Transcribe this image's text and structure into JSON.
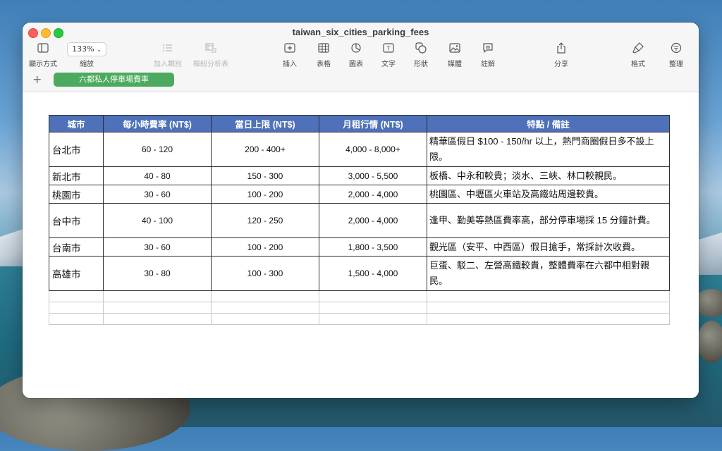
{
  "window": {
    "title": "taiwan_six_cities_parking_fees"
  },
  "toolbar": {
    "view_label": "顯示方式",
    "zoom_value": "133%",
    "zoom_label": "縮放",
    "add_category_label": "加入類別",
    "pivot_label": "樞紐分析表",
    "insert_label": "插入",
    "table_label": "表格",
    "chart_label": "圖表",
    "text_label": "文字",
    "shape_label": "形狀",
    "media_label": "媒體",
    "comment_label": "註解",
    "share_label": "分享",
    "format_label": "格式",
    "organize_label": "整理"
  },
  "sheets": {
    "add_icon": "plus-icon",
    "active_tab": "六都私人停車場費率"
  },
  "table": {
    "headers": [
      "城市",
      "每小時費率 (NT$)",
      "當日上限 (NT$)",
      "月租行情 (NT$)",
      "特點 / 備註"
    ],
    "rows": [
      {
        "city": "台北市",
        "hourly": "60 - 120",
        "daily": "200 - 400+",
        "monthly": "4,000 - 8,000+",
        "note": "精華區假日 $100 - 150/hr 以上，熱門商圈假日多不設上限。"
      },
      {
        "city": "新北市",
        "hourly": "40 - 80",
        "daily": "150 - 300",
        "monthly": "3,000 - 5,500",
        "note": "板橋、中永和較貴；淡水、三峽、林口較親民。"
      },
      {
        "city": "桃園市",
        "hourly": "30 - 60",
        "daily": "100 - 200",
        "monthly": "2,000 - 4,000",
        "note": "桃園區、中壢區火車站及高鐵站周邊較貴。"
      },
      {
        "city": "台中市",
        "hourly": "40 - 100",
        "daily": "120 - 250",
        "monthly": "2,000 - 4,000",
        "note": "逢甲、勤美等熱區費率高，部分停車場採 15 分鐘計費。"
      },
      {
        "city": "台南市",
        "hourly": "30 - 60",
        "daily": "100 - 200",
        "monthly": "1,800 - 3,500",
        "note": "觀光區（安平、中西區）假日搶手，常採計次收費。"
      },
      {
        "city": "高雄市",
        "hourly": "30 - 80",
        "daily": "100 - 300",
        "monthly": "1,500 - 4,000",
        "note": "巨蛋、駁二、左營高鐵較貴，整體費率在六都中相對親民。"
      }
    ]
  },
  "colors": {
    "header_bg": "#4e71b9",
    "tab_bg": "#4caa5e"
  }
}
